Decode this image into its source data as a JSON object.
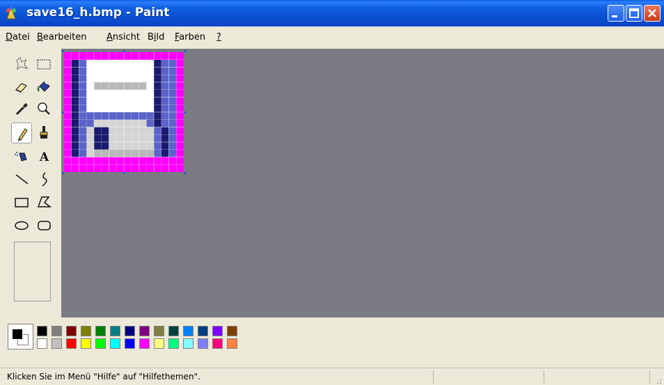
{
  "window": {
    "title": "save16_h.bmp - Paint"
  },
  "menu": [
    {
      "label": "Datei",
      "ul": "D",
      "rest": "atei"
    },
    {
      "label": "Bearbeiten",
      "ul": "B",
      "rest": "earbeiten"
    },
    {
      "label": "Ansicht",
      "ul": "A",
      "rest": "nsicht"
    },
    {
      "label": "Bild",
      "pre": "B",
      "ul": "i",
      "rest": "ld"
    },
    {
      "label": "Farben",
      "ul": "F",
      "rest": "arben"
    },
    {
      "label": "?",
      "ul": "?",
      "rest": ""
    }
  ],
  "tools": [
    {
      "name": "free-select",
      "icon": "free-select-icon"
    },
    {
      "name": "rect-select",
      "icon": "rect-select-icon"
    },
    {
      "name": "eraser",
      "icon": "eraser-icon"
    },
    {
      "name": "fill",
      "icon": "fill-bucket-icon"
    },
    {
      "name": "pick-color",
      "icon": "eyedropper-icon"
    },
    {
      "name": "magnifier",
      "icon": "magnifier-icon"
    },
    {
      "name": "pencil",
      "icon": "pencil-icon",
      "selected": true
    },
    {
      "name": "brush",
      "icon": "brush-icon"
    },
    {
      "name": "airbrush",
      "icon": "airbrush-icon"
    },
    {
      "name": "text",
      "icon": "text-icon",
      "glyph": "A"
    },
    {
      "name": "line",
      "icon": "line-icon"
    },
    {
      "name": "curve",
      "icon": "curve-icon"
    },
    {
      "name": "rectangle",
      "icon": "rectangle-icon"
    },
    {
      "name": "polygon",
      "icon": "polygon-icon"
    },
    {
      "name": "ellipse",
      "icon": "ellipse-icon"
    },
    {
      "name": "rounded-rectangle",
      "icon": "rounded-rectangle-icon"
    }
  ],
  "colors": {
    "foreground": "#000000",
    "background": "#ffffff",
    "palette_top": [
      "#000000",
      "#808080",
      "#800000",
      "#808000",
      "#008000",
      "#008080",
      "#000080",
      "#800080",
      "#808040",
      "#004040",
      "#0080ff",
      "#004080",
      "#8000ff",
      "#804000"
    ],
    "palette_bottom": [
      "#ffffff",
      "#c0c0c0",
      "#ff0000",
      "#ffff00",
      "#00ff00",
      "#00ffff",
      "#0000ff",
      "#ff00ff",
      "#ffff80",
      "#00ff80",
      "#80ffff",
      "#8080ff",
      "#ff0080",
      "#ff8040"
    ]
  },
  "status": {
    "text": "Klicken Sie im Menü \"Hilfe\" auf \"Hilfethemen\"."
  }
}
